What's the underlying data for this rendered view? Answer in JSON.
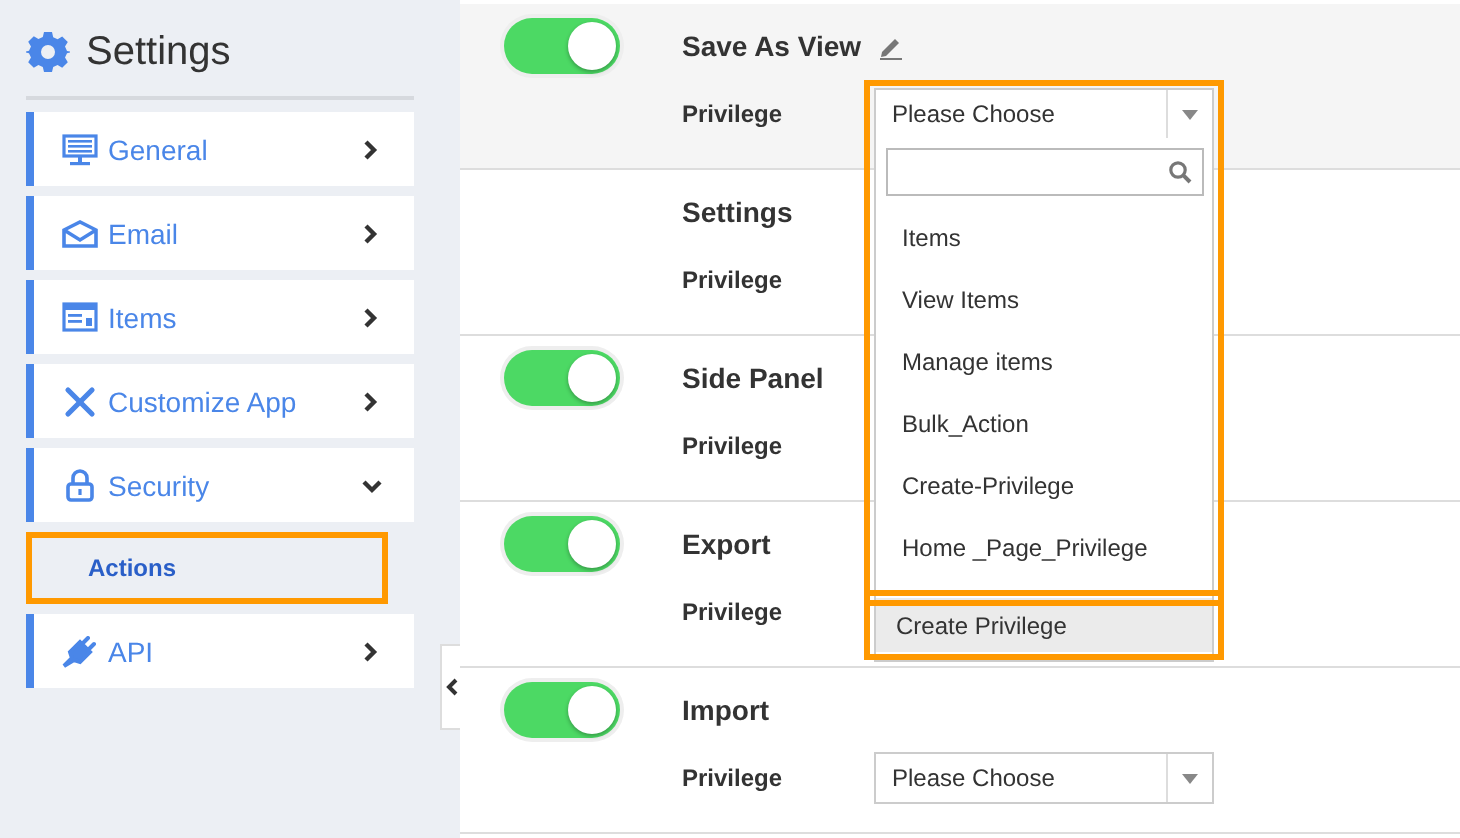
{
  "sidebar": {
    "title": "Settings",
    "items": [
      {
        "label": "General",
        "expanded": false
      },
      {
        "label": "Email",
        "expanded": false
      },
      {
        "label": "Items",
        "expanded": false
      },
      {
        "label": "Customize App",
        "expanded": false
      },
      {
        "label": "Security",
        "expanded": true,
        "children": [
          {
            "label": "Actions",
            "selected": true,
            "callout": true
          }
        ]
      },
      {
        "label": "API",
        "expanded": false
      }
    ]
  },
  "rows": [
    {
      "kind": "switch",
      "on": true,
      "title": "Save As View",
      "editable": true,
      "privilege_label": "Privilege",
      "select": {
        "value": "Please Choose",
        "open": true
      }
    },
    {
      "kind": "plain",
      "title": "Settings",
      "editable": false,
      "privilege_label": "Privilege"
    },
    {
      "kind": "switch",
      "on": true,
      "title": "Side Panel",
      "editable": false,
      "privilege_label": "Privilege"
    },
    {
      "kind": "switch",
      "on": true,
      "title": "Export",
      "editable": false,
      "privilege_label": "Privilege"
    },
    {
      "kind": "switch",
      "on": true,
      "title": "Import",
      "editable": false,
      "privilege_label": "Privilege",
      "select": {
        "value": "Please Choose",
        "open": false
      }
    }
  ],
  "dropdown": {
    "callout": true,
    "options": [
      {
        "label": "Items",
        "highlighted": false,
        "callout": false
      },
      {
        "label": "View Items",
        "highlighted": false,
        "callout": false
      },
      {
        "label": "Manage items",
        "highlighted": false,
        "callout": false
      },
      {
        "label": "Bulk_Action",
        "highlighted": false,
        "callout": false
      },
      {
        "label": "Create-Privilege",
        "highlighted": false,
        "callout": false
      },
      {
        "label": "Home _Page_Privilege",
        "highlighted": false,
        "callout": false
      },
      {
        "label": "Create Privilege",
        "highlighted": true,
        "callout": true
      }
    ]
  }
}
